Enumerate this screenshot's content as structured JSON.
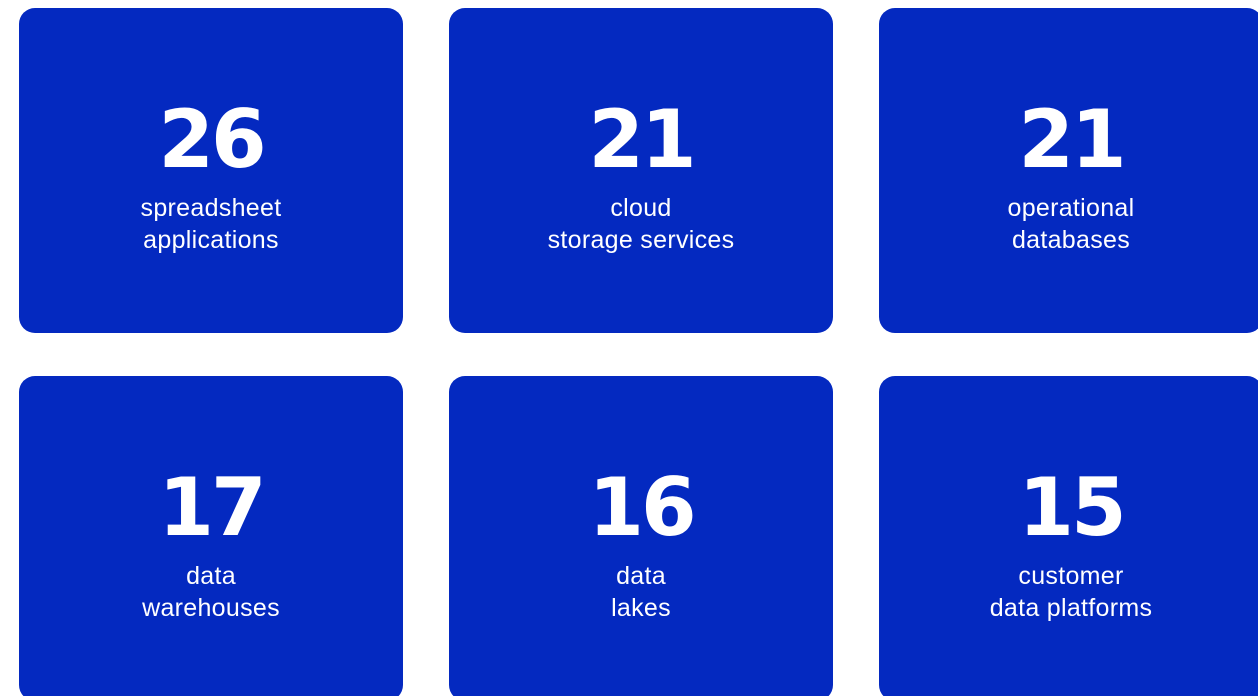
{
  "theme": {
    "card_color": "#0429c0",
    "text_color": "#ffffff",
    "background": "#ffffff"
  },
  "stats": [
    {
      "value": "26",
      "label_line1": "spreadsheet",
      "label_line2": "applications"
    },
    {
      "value": "21",
      "label_line1": "cloud",
      "label_line2": "storage services"
    },
    {
      "value": "21",
      "label_line1": "operational",
      "label_line2": "databases"
    },
    {
      "value": "17",
      "label_line1": "data",
      "label_line2": "warehouses"
    },
    {
      "value": "16",
      "label_line1": "data",
      "label_line2": "lakes"
    },
    {
      "value": "15",
      "label_line1": "customer",
      "label_line2": "data platforms"
    }
  ]
}
